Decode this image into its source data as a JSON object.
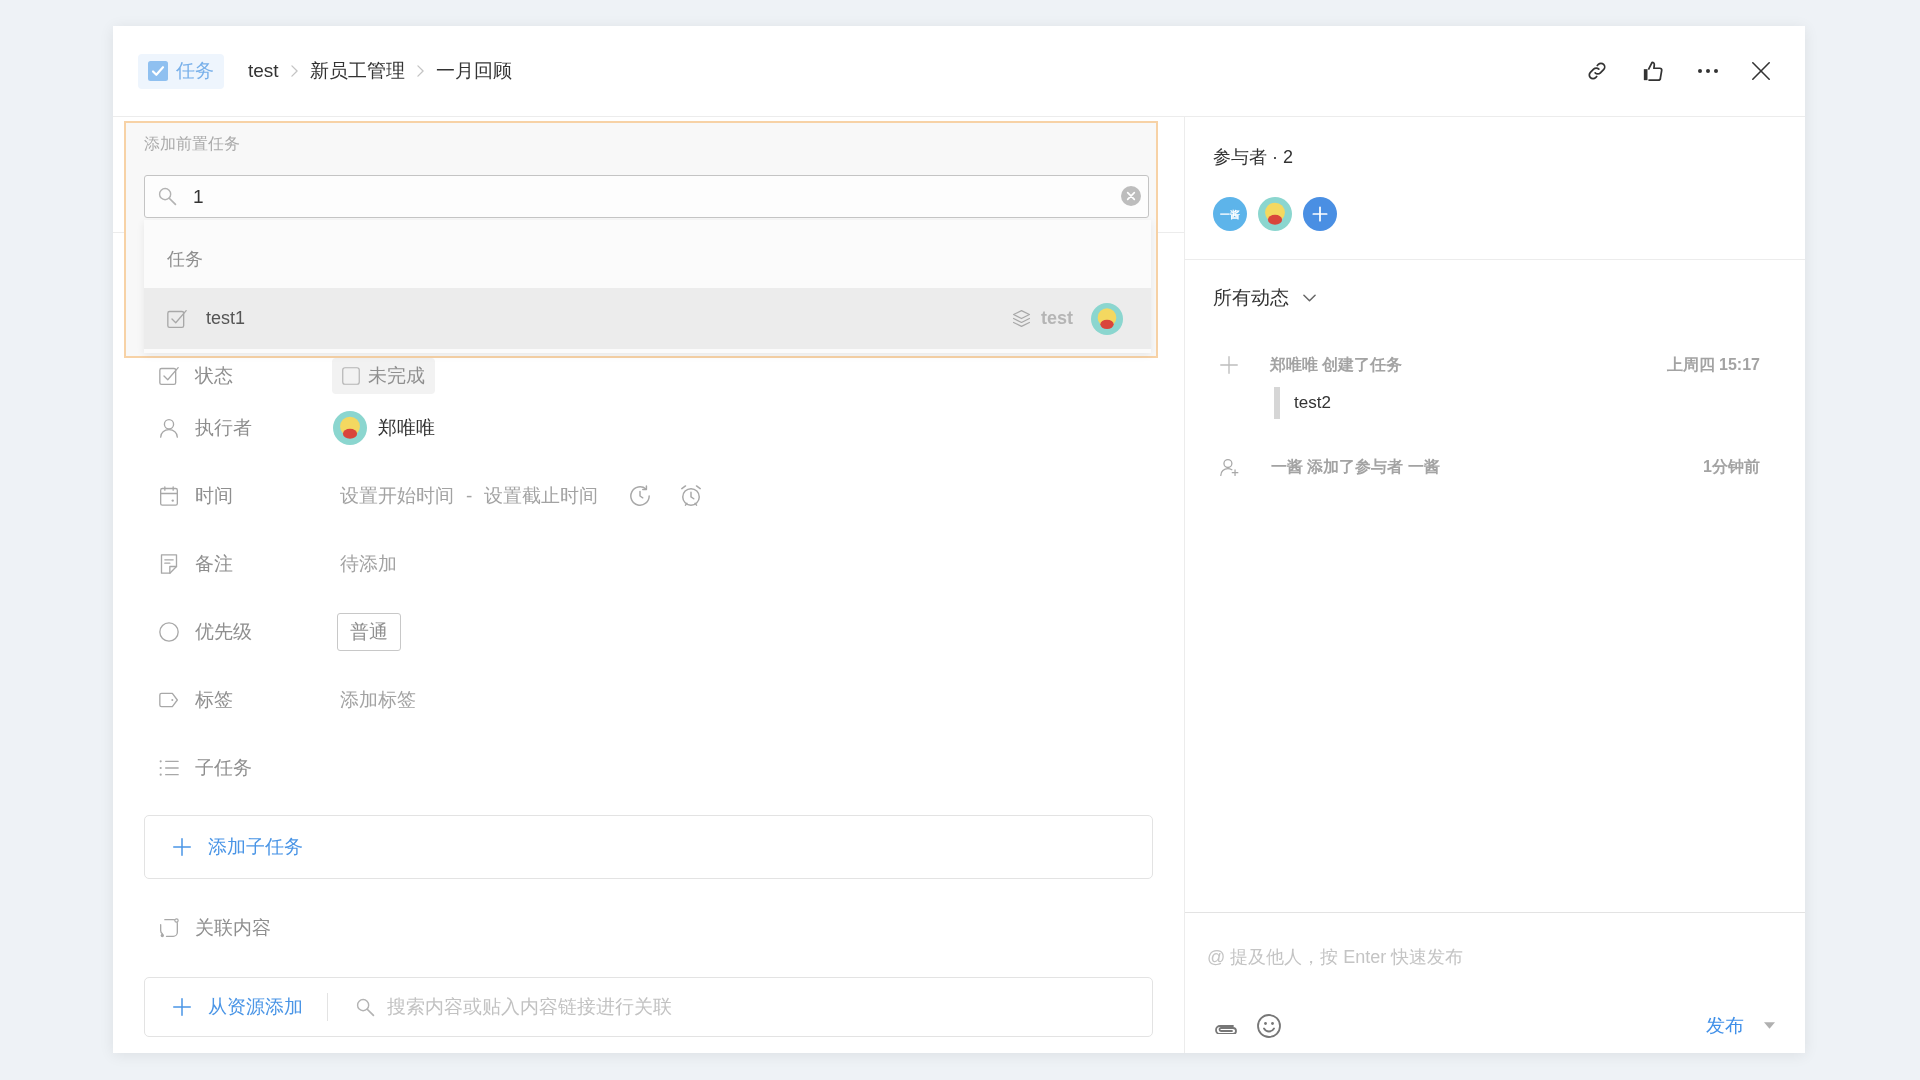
{
  "header": {
    "type_tag": {
      "label": "任务"
    },
    "breadcrumb": [
      "test",
      "新员工管理",
      "一月回顾"
    ]
  },
  "dependency_picker": {
    "title": "添加前置任务",
    "search": {
      "value": "1"
    },
    "group": "任务",
    "results": [
      {
        "title": "test1",
        "project": "test",
        "selected": true
      }
    ]
  },
  "fields": [
    {
      "kind": "status",
      "label": "状态",
      "value": "未完成",
      "checked": false
    },
    {
      "kind": "assignee",
      "label": "执行者",
      "value": "郑唯唯"
    },
    {
      "kind": "time",
      "label": "时间",
      "start": "设置开始时间",
      "separator": "-",
      "end": "设置截止时间"
    },
    {
      "kind": "note",
      "label": "备注",
      "value": "待添加"
    },
    {
      "kind": "priority",
      "label": "优先级",
      "value": "普通"
    },
    {
      "kind": "tags",
      "label": "标签",
      "value": "添加标签"
    },
    {
      "kind": "subtasks",
      "label": "子任务"
    }
  ],
  "add_subtask": {
    "label": "添加子任务"
  },
  "related": {
    "label": "关联内容",
    "add_button": "从资源添加",
    "search": {
      "placeholder": "搜索内容或贴入内容链接进行关联"
    }
  },
  "participants": {
    "title": "参与者 · 2",
    "members": [
      {
        "kind": "initials",
        "text": "一酱"
      },
      {
        "kind": "picture"
      }
    ]
  },
  "activity": {
    "filter": "所有动态",
    "items": [
      {
        "kind": "created",
        "text": "郑唯唯 创建了任务",
        "time": "上周四 15:17",
        "quote": "test2"
      },
      {
        "kind": "participant_added",
        "text": "一酱 添加了参与者 一酱",
        "time": "1分钟前"
      }
    ]
  },
  "comment": {
    "placeholder": "@ 提及他人，按 Enter 快速发布",
    "submit": "发布"
  }
}
